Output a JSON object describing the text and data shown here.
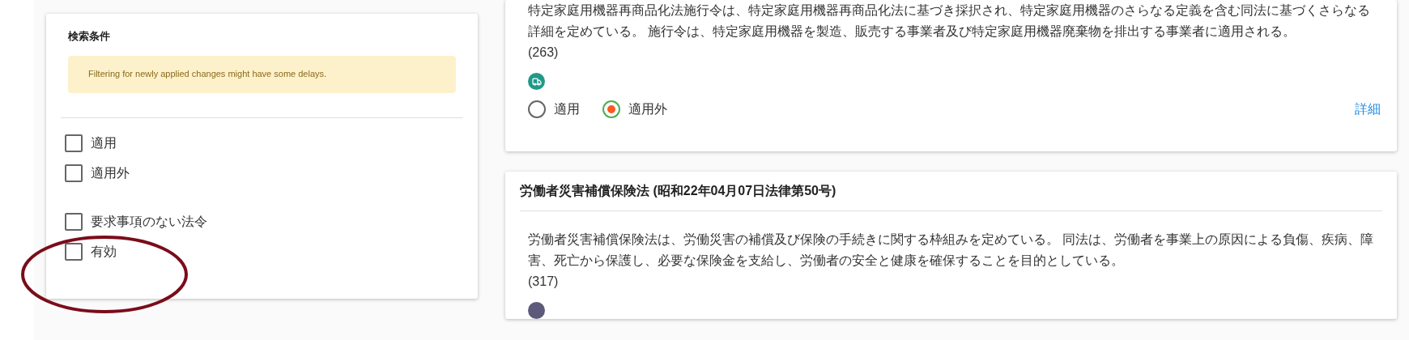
{
  "filter_panel": {
    "title": "検索条件",
    "notice": "Filtering for newly applied changes might have some delays.",
    "groups": [
      [
        {
          "label": "適用",
          "checked": false
        },
        {
          "label": "適用外",
          "checked": false
        }
      ],
      [
        {
          "label": "要求事項のない法令",
          "checked": false
        },
        {
          "label": "有効",
          "checked": false
        }
      ]
    ]
  },
  "laws": [
    {
      "description": "特定家庭用機器再商品化法施行令は、特定家庭用機器再商品化法に基づき採択され、特定家庭用機器のさらなる定義を含む同法に基づくさらなる詳細を定めている。 施行令は、特定家庭用機器を製造、販売する事業者及び特定家庭用機器廃棄物を排出する事業者に適用される。",
      "count": "(263)",
      "color": "#1f9a88",
      "options": [
        {
          "label": "適用",
          "selected": false
        },
        {
          "label": "適用外",
          "selected": true
        }
      ],
      "link": "詳細"
    },
    {
      "title": "労働者災害補償保険法 (昭和22年04月07日法律第50号)",
      "description": "労働者災害補償保険法は、労働災害の補償及び保険の手続きに関する枠組みを定めている。 同法は、労働者を事業上の原因による負傷、疾病、障害、死亡から保護し、必要な保険金を支給し、労働者の安全と健康を確保することを目的としている。",
      "count": "(317)",
      "color": "#5c5a7a"
    }
  ],
  "annotation": {
    "kind": "ellipse"
  }
}
